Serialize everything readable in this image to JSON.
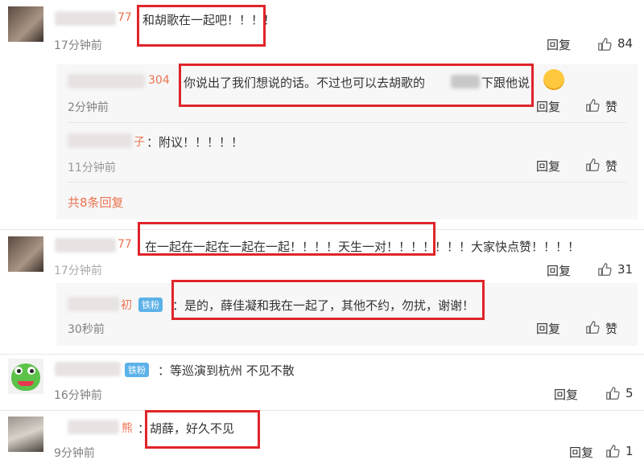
{
  "comments": [
    {
      "name_tail": "77",
      "text": "和胡歌在一起吧！！！！",
      "time": "17分钟前",
      "reply": "回复",
      "likes": "84",
      "subreplies": [
        {
          "name_tail": "304",
          "text": "你说出了我们想说的话。不过也可以去胡歌的",
          "text2": "下跟他说",
          "time": "2分钟前",
          "reply": "回复",
          "like_label": "赞"
        },
        {
          "name_tail": "子",
          "text": "：附议！！！！！",
          "time": "11分钟前",
          "reply": "回复",
          "like_label": "赞"
        }
      ],
      "more": "共8条回复"
    },
    {
      "name_tail": "77",
      "text": "在一起在一起在一起在一起！！！！天生一对！！！！！！！大家快点赞！！！！",
      "time": "17分钟前",
      "reply": "回复",
      "likes": "31",
      "subreplies": [
        {
          "name_tail": "初",
          "badge": "铁粉",
          "text": "：是的，薛佳凝和我在一起了，其他不约，勿扰，谢谢！",
          "time": "30秒前",
          "reply": "回复",
          "like_label": "赞"
        }
      ]
    },
    {
      "badge": "铁粉",
      "text": "：等巡演到杭州 不见不散",
      "time": "16分钟前",
      "reply": "回复",
      "likes": "5"
    },
    {
      "name_tail": "熊",
      "text": "：胡薛，好久不见",
      "time": "9分钟前",
      "reply": "回复",
      "likes": "1"
    }
  ]
}
